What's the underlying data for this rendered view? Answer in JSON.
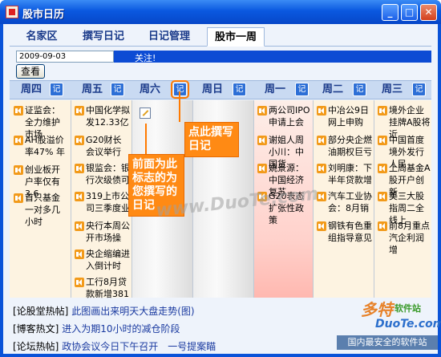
{
  "window": {
    "title": "股市日历",
    "controls": {
      "minimize": "_",
      "maximize": "□",
      "close": "✕"
    }
  },
  "tabs": [
    {
      "label": "名家区"
    },
    {
      "label": "撰写日记"
    },
    {
      "label": "日记管理"
    },
    {
      "label": "股市一周",
      "active": true
    }
  ],
  "controls": {
    "date_value": "2009-09-03",
    "notice": "关注!",
    "view_button": "查看"
  },
  "days": [
    {
      "name": "周四",
      "ji": "记"
    },
    {
      "name": "周五",
      "ji": "记"
    },
    {
      "name": "周六",
      "ji": "记"
    },
    {
      "name": "周日",
      "ji": "记"
    },
    {
      "name": "周一",
      "ji": "记"
    },
    {
      "name": "周二",
      "ji": "记"
    },
    {
      "name": "周三",
      "ji": "记"
    }
  ],
  "columns": {
    "thu": [
      "证监会：全力维护市场",
      "AH股溢价率47% 年",
      "创业板开户率仅有3.6",
      "首只基金一对多几小时"
    ],
    "fri": [
      "中国化学拟发12.33亿",
      "G20财长会议举行",
      "银监会：银行次级债可",
      "319上市公司三季度业",
      "央行本周公开市场操",
      "央企缩编进入倒计时",
      "工行8月贷款新增381"
    ],
    "mon": [
      "两公司IPO申请上会",
      "谢姐人周小川：中国货",
      "姚景源：中国经济复苏",
      "G20表态扩张性政策"
    ],
    "tue": [
      "中冶公9日网上申购",
      "部分央企燃油期权巨亏",
      "刘明康：下半年贷款增",
      "汽车工业协会：8月销",
      "钢铁有色重组指导意见"
    ],
    "wed": [
      "境外企业挂牌A股将近",
      "中国首度境外发行人民",
      "上周基金A股开户创新",
      "美三大股指周二全线上",
      "前8月重点汽企利润增"
    ]
  },
  "annotations": {
    "write_here": "点此撰写日记",
    "past_note": "前面为此标志的为您撰写的日记"
  },
  "footer": [
    {
      "tag": "[论股堂热帖]",
      "text": "此图画出来明天大盘走势(图)"
    },
    {
      "tag": "[博客热文]",
      "text": "进入为期10小时的减仓阶段"
    },
    {
      "tag": "[论坛热帖]",
      "text": "政协会议今日下午召开　一号提案瞄"
    }
  ],
  "watermark": "www.DuoTe.com",
  "logo": {
    "main": "多特",
    "sub": "软件站",
    "domain": "DuoTe.com",
    "tagline": "国内最安全的软件站"
  },
  "colors": {
    "title_blue": "#0a58e0",
    "annotation": "#ff8a14",
    "link": "#1a3aa0"
  }
}
